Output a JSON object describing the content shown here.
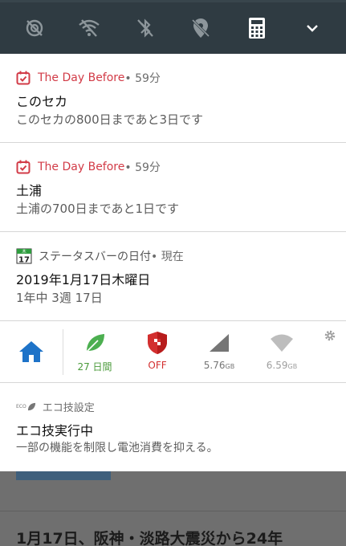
{
  "quick_settings": {
    "icons": [
      "data-saver-icon",
      "wifi-off-icon",
      "bluetooth-off-icon",
      "location-off-icon",
      "calculator-icon",
      "expand-icon"
    ]
  },
  "notifications": [
    {
      "app": "The Day Before",
      "meta": " • 59分",
      "title": "このセカ",
      "body": "このセカの800日まであと3日です",
      "icon": "calendar-check-icon"
    },
    {
      "app": "The Day Before",
      "meta": " • 59分",
      "title": "土浦",
      "body": "土浦の700日まであと1日です",
      "icon": "calendar-check-icon"
    },
    {
      "app": "ステータスバーの日付",
      "meta": " • 現在",
      "title": "2019年1月17日木曜日",
      "body": "1年中 3週 17日",
      "icon": "calendar-17-icon",
      "icon_day": "17",
      "icon_top": "木"
    }
  ],
  "widget": {
    "eco_days": "27 日間",
    "security": "OFF",
    "mobile_data": "5.76",
    "wifi_data": "6.59",
    "unit": "GB"
  },
  "eco": {
    "badge": "ECO",
    "header": "エコ技設定",
    "title": "エコ技実行中",
    "body": "一部の機能を制限し電池消費を抑える。"
  },
  "background": {
    "headline": "1月17日、阪神・淡路大震災から24年"
  },
  "colors": {
    "qs_bar": "#2f3b42",
    "app_red": "#d23b47",
    "home_blue": "#1e73c8",
    "eco_green": "#4caf50",
    "security_red": "#d32f2f"
  }
}
